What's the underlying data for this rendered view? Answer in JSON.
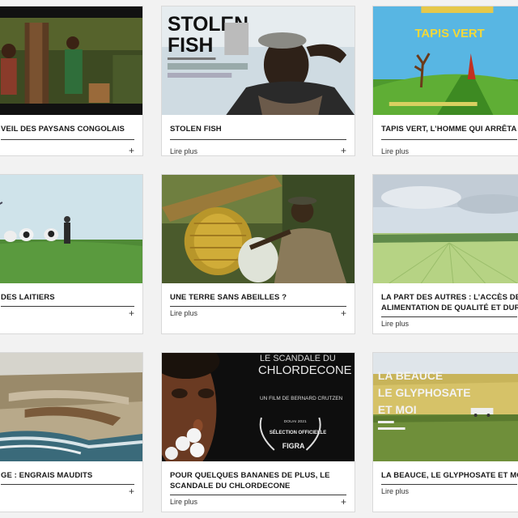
{
  "cards": [
    {
      "title": "VEIL DES PAYSANS CONGOLAIS",
      "more": "",
      "plus": "+"
    },
    {
      "title": "STOLEN FISH",
      "more": "Lire plus",
      "plus": "+",
      "poster_title_1": "STOLEN",
      "poster_title_2": "FISH"
    },
    {
      "title": "TAPIS VERT, L’HOMME QUI ARRÊTA LE D",
      "more": "Lire plus",
      "plus": "",
      "poster_title": "TAPIS VERT"
    },
    {
      "title": "DES LAITIERS",
      "more": "",
      "plus": "+"
    },
    {
      "title": "UNE TERRE SANS ABEILLES ?",
      "more": "Lire plus",
      "plus": "+"
    },
    {
      "title_line1": "LA PART DES AUTRES : L’ACCÈS DE TOU",
      "title_line2": "ALIMENTATION DE QUALITÉ ET DURAB",
      "more": "Lire plus",
      "plus": ""
    },
    {
      "title": "GE : ENGRAIS MAUDITS",
      "more": "",
      "plus": "+"
    },
    {
      "title_line1": "POUR QUELQUES BANANES DE PLUS, LE",
      "title_line2": "SCANDALE DU CHLORDECONE",
      "more": "Lire plus",
      "plus": "+",
      "poster_top_1": "LE SCANDALE DU",
      "poster_top_2": "CHLORDECONE",
      "poster_credit": "UN FILM DE BERNARD CRUTZEN",
      "poster_festival": "DOUAI 2021",
      "poster_selection": "SÉLECTION OFFICIELLE",
      "poster_figra": "FIGRA"
    },
    {
      "title": "LA BEAUCE, LE GLYPHOSATE ET MOI",
      "more": "Lire plus",
      "plus": "",
      "poster_l1": "LA BEAUCE",
      "poster_l2": "LE GLYPHOSATE",
      "poster_l3": "ET MOI"
    }
  ]
}
